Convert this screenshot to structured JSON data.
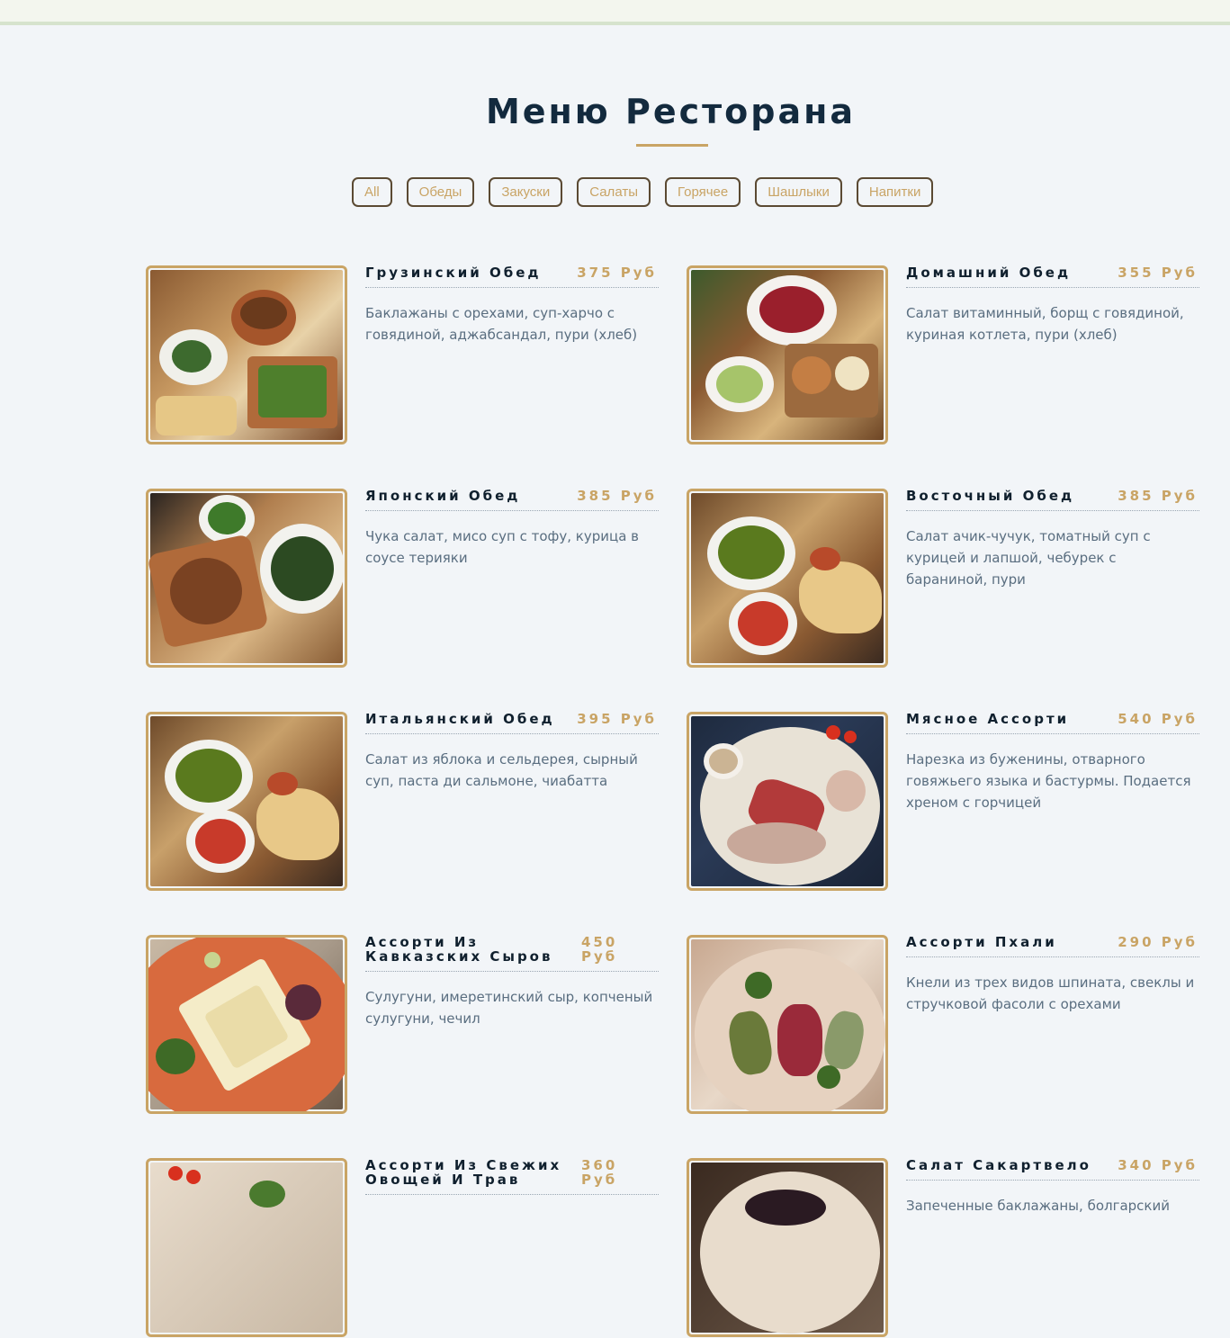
{
  "page": {
    "title": "Меню Ресторана"
  },
  "filters": [
    {
      "label": "All"
    },
    {
      "label": "Обеды"
    },
    {
      "label": "Закуски"
    },
    {
      "label": "Салаты"
    },
    {
      "label": "Горячее"
    },
    {
      "label": "Шашлыки"
    },
    {
      "label": "Напитки"
    }
  ],
  "menu": [
    {
      "name": "Грузинский Обед",
      "price": "375 Руб",
      "description": "Баклажаны с орехами, суп-харчо с говядиной, аджабсандал, пури (хлеб)"
    },
    {
      "name": "Домашний Обед",
      "price": "355 Руб",
      "description": "Салат витаминный, борщ с говядиной, куриная котлета, пури (хлеб)"
    },
    {
      "name": "Японский Обед",
      "price": "385 Руб",
      "description": "Чука салат, мисо суп с тофу, курица в соусе терияки"
    },
    {
      "name": "Восточный Обед",
      "price": "385 Руб",
      "description": "Салат ачик-чучук, томатный суп с курицей и лапшой, чебурек с бараниной, пури"
    },
    {
      "name": "Итальянский Обед",
      "price": "395 Руб",
      "description": "Салат из яблока и сельдерея, сырный суп, паста ди сальмоне, чиабатта"
    },
    {
      "name": "Мясное Ассорти",
      "price": "540 Руб",
      "description": "Нарезка из буженины, отварного говяжьего языка и бастурмы. Подается хреном с горчицей"
    },
    {
      "name": "Ассорти Из Кавказских Сыров",
      "price": "450 Руб",
      "description": "Сулугуни, имеретинский сыр, копченый сулугуни, чечил"
    },
    {
      "name": "Ассорти Пхали",
      "price": "290 Руб",
      "description": "Кнели из трех видов шпината, свеклы и стручковой фасоли с орехами"
    },
    {
      "name": "Ассорти Из Свежих Овощей И Трав",
      "price": "360 Руб",
      "description": ""
    },
    {
      "name": "Салат Сакартвело",
      "price": "340 Руб",
      "description": "Запеченные баклажаны, болгарский"
    }
  ],
  "colors": {
    "accent": "#c9a465",
    "heading": "#132a3e",
    "text": "#5a6e80",
    "background": "#f2f5f8"
  }
}
